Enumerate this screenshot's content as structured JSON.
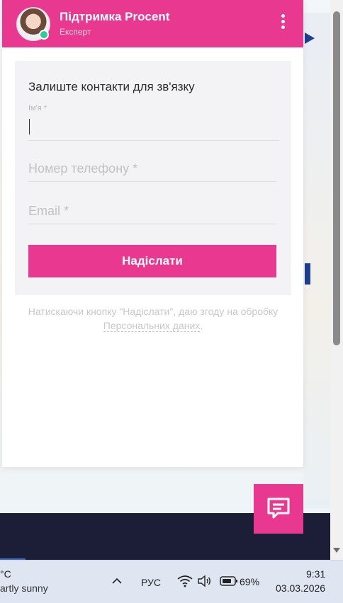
{
  "chat": {
    "title": "Підтримка Procent",
    "subtitle": "Експерт",
    "menu_icon": "more-vertical-icon",
    "form": {
      "heading": "Залиште контакти для зв'язку",
      "name_label": "Ім'я *",
      "name_value": "",
      "phone_placeholder": "Номер телефону *",
      "email_placeholder": "Email *",
      "submit_label": "Надіслати"
    },
    "consent_text": "Натискаючи кнопку \"Надіслати\", даю згоду на обробку ",
    "consent_link": "Персональних даних",
    "consent_end": ".",
    "fab_icon": "chat-bubble-icon",
    "accent_color": "#e8388f"
  },
  "taskbar": {
    "weather_temp": "°C",
    "weather_desc": "artly sunny",
    "language": "РУС",
    "battery_percent": "69%",
    "time": "9:31",
    "date": "03.03.2026"
  }
}
